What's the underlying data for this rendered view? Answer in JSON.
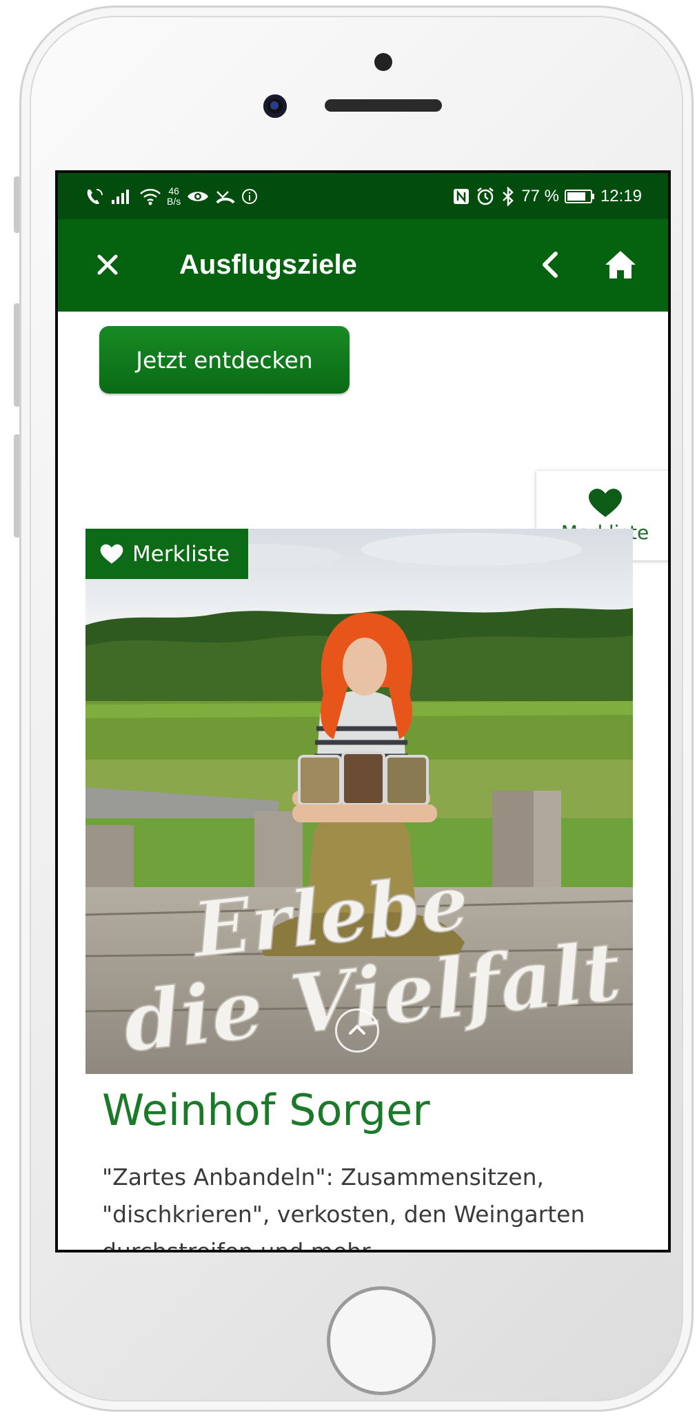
{
  "status": {
    "speed_top": "46",
    "speed_unit": "B/s",
    "battery": "77 %",
    "time": "12:19"
  },
  "appbar": {
    "title": "Ausflugsziele"
  },
  "cta": {
    "label": "Jetzt entdecken"
  },
  "merkliste_float": {
    "label": "Merkliste"
  },
  "card": {
    "badge_label": "Merkliste",
    "image_overlay_text_line1": "Erlebe",
    "image_overlay_text_line2": "die Vielfalt",
    "title": "Weinhof Sorger",
    "description": "\"Zartes Anbandeln\": Zusammensitzen, \"dischkrieren\", verkosten, den Weingarten durchstreifen und mehr",
    "description_visible": "\"Zartes Anbandeln\": Zusammensitzen, \"dischkrieren\", verkosten, den"
  },
  "colors": {
    "statusbar": "#024d0d",
    "appbar": "#05620f",
    "accent": "#1b7a2a",
    "button_green": "#0a6a15"
  },
  "icons": {
    "close": "close-icon",
    "back": "chevron-left-icon",
    "home": "home-icon",
    "heart": "heart-icon",
    "scroll_up": "chevron-up-icon"
  }
}
